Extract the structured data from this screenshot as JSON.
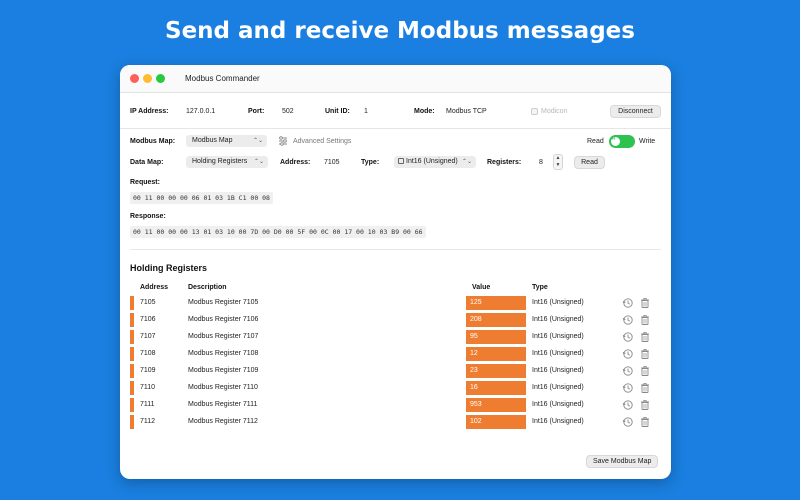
{
  "headline": "Send and receive Modbus messages",
  "window": {
    "title": "Modbus Commander"
  },
  "connection": {
    "ip_label": "IP Address:",
    "ip_value": "127.0.0.1",
    "port_label": "Port:",
    "port_value": "502",
    "unit_label": "Unit ID:",
    "unit_value": "1",
    "mode_label": "Mode:",
    "mode_value": "Modbus TCP",
    "modicon_label": "Modicon",
    "disconnect_label": "Disconnect"
  },
  "controls": {
    "map_label": "Modbus Map:",
    "map_value": "Modbus Map",
    "advanced_label": "Advanced Settings",
    "read_label": "Read",
    "toggle_knob": "R",
    "write_label": "Write",
    "datamap_label": "Data Map:",
    "datamap_value": "Holding Registers",
    "address_label": "Address:",
    "address_value": "7105",
    "type_label": "Type:",
    "type_value": "Int16 (Unsigned)",
    "registers_label": "Registers:",
    "registers_value": "8",
    "read_button": "Read"
  },
  "request": {
    "label": "Request:",
    "hex": "00 11 00 00 00 06 01 03 1B C1 00 08"
  },
  "response": {
    "label": "Response:",
    "hex": "00 11 00 00 00 13 01 03 10 00 7D 00 D0 00 5F 00 0C 00 17 00 10 03 B9 00 66"
  },
  "table": {
    "title": "Holding Registers",
    "headers": {
      "address": "Address",
      "description": "Description",
      "value": "Value",
      "type": "Type"
    },
    "rows": [
      {
        "address": "7105",
        "description": "Modbus Register 7105",
        "value": "125",
        "type": "Int16 (Unsigned)"
      },
      {
        "address": "7106",
        "description": "Modbus Register 7106",
        "value": "208",
        "type": "Int16 (Unsigned)"
      },
      {
        "address": "7107",
        "description": "Modbus Register 7107",
        "value": "95",
        "type": "Int16 (Unsigned)"
      },
      {
        "address": "7108",
        "description": "Modbus Register 7108",
        "value": "12",
        "type": "Int16 (Unsigned)"
      },
      {
        "address": "7109",
        "description": "Modbus Register 7109",
        "value": "23",
        "type": "Int16 (Unsigned)"
      },
      {
        "address": "7110",
        "description": "Modbus Register 7110",
        "value": "16",
        "type": "Int16 (Unsigned)"
      },
      {
        "address": "7111",
        "description": "Modbus Register 7111",
        "value": "953",
        "type": "Int16 (Unsigned)"
      },
      {
        "address": "7112",
        "description": "Modbus Register 7112",
        "value": "102",
        "type": "Int16 (Unsigned)"
      }
    ]
  },
  "footer": {
    "save_label": "Save Modbus Map"
  },
  "colors": {
    "background": "#1a7fe0",
    "accent": "#ee7d32",
    "toggle": "#2ec24f"
  }
}
